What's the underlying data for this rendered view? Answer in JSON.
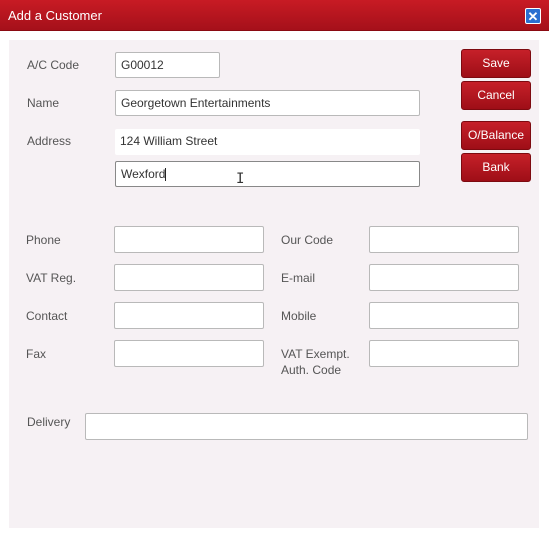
{
  "window": {
    "title": "Add a Customer",
    "close_icon": "close-icon"
  },
  "fields": {
    "ac_code": {
      "label": "A/C Code",
      "value": "G00012"
    },
    "name": {
      "label": "Name",
      "value": "Georgetown Entertainments"
    },
    "address": {
      "label": "Address",
      "line1": "124 William Street",
      "line2": "Wexford"
    },
    "phone": {
      "label": "Phone",
      "value": ""
    },
    "our_code": {
      "label": "Our Code",
      "value": ""
    },
    "vat_reg": {
      "label": "VAT Reg.",
      "value": ""
    },
    "email": {
      "label": "E-mail",
      "value": ""
    },
    "contact": {
      "label": "Contact",
      "value": ""
    },
    "mobile": {
      "label": "Mobile",
      "value": ""
    },
    "fax": {
      "label": "Fax",
      "value": ""
    },
    "vat_exempt": {
      "label_line1": "VAT Exempt.",
      "label_line2": "Auth. Code",
      "value": ""
    },
    "delivery": {
      "label": "Delivery",
      "value": ""
    }
  },
  "buttons": {
    "save": "Save",
    "cancel": "Cancel",
    "obalance": "O/Balance",
    "bank": "Bank"
  },
  "colors": {
    "titlebar": "#b5141d",
    "button": "#b0141c",
    "panel": "#f6f1f4",
    "close": "#2a6fd0"
  }
}
